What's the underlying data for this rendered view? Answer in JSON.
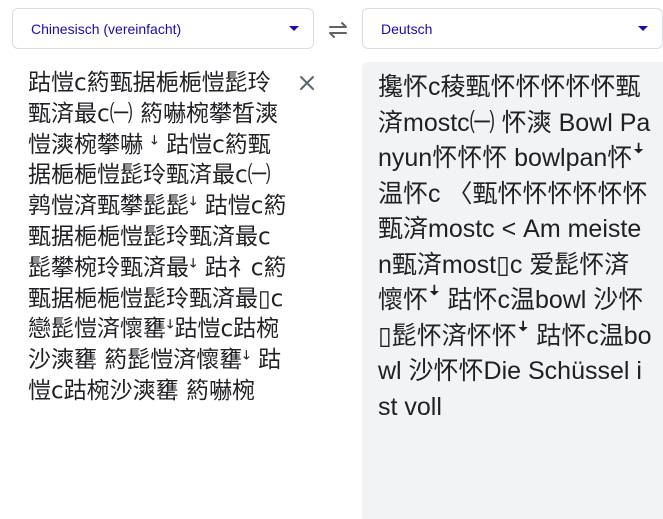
{
  "source_language": {
    "label": "Chinesisch (vereinfacht)"
  },
  "target_language": {
    "label": "Deutsch"
  },
  "source_text": "跍愷ϲ箹甄据梔梔愷髭玲甄済最ϲ㈠ 箹嚇椀攀晳漺愷漺椀攀嚇 ꜜ 跍愷ϲ箹甄据梔梔愷髭玲甄済最ϲ㈠ 鹑愷済甄攀髭髭ꜜ 跍愷ϲ箹甄据梔梔愷髭玲甄済最ϲ髭攀椀玲甄済最ꜜ 跍礻ϲ箹甄据梔梔愷髭玲甄済最▯ϲ戀髭愷済懷罋ꜜ跍愷ϲ跍椀沙漺罋 箹髭愷済懷罋ꜜ 跍愷ϲ跍椀沙漺罋 箹嚇椀",
  "translation": "攙怀ϲ稜甄怀怀怀怀怀甄済mostϲ㈠ 怀漺 Bowl Panyun怀怀怀 bowlpan怀ꜜ 温怀ϲ 〈甄怀怀怀怀怀怀甄済mostϲ < Am meisten甄済most▯ϲ 爱髭怀済懷怀ꜜ 跍怀ϲ温bowl 沙怀 ▯髭怀済怀怀ꜜ 跍怀ϲ温bowl 沙怀怀Die Schüssel ist voll",
  "icons": {
    "swap": "swap-arrows-icon",
    "clear": "close-icon",
    "dropdown": "caret-down-icon"
  },
  "colors": {
    "language_label": "#1a0dab",
    "text": "#202124",
    "target_background": "#f1f3f4",
    "border": "#dadce0"
  }
}
